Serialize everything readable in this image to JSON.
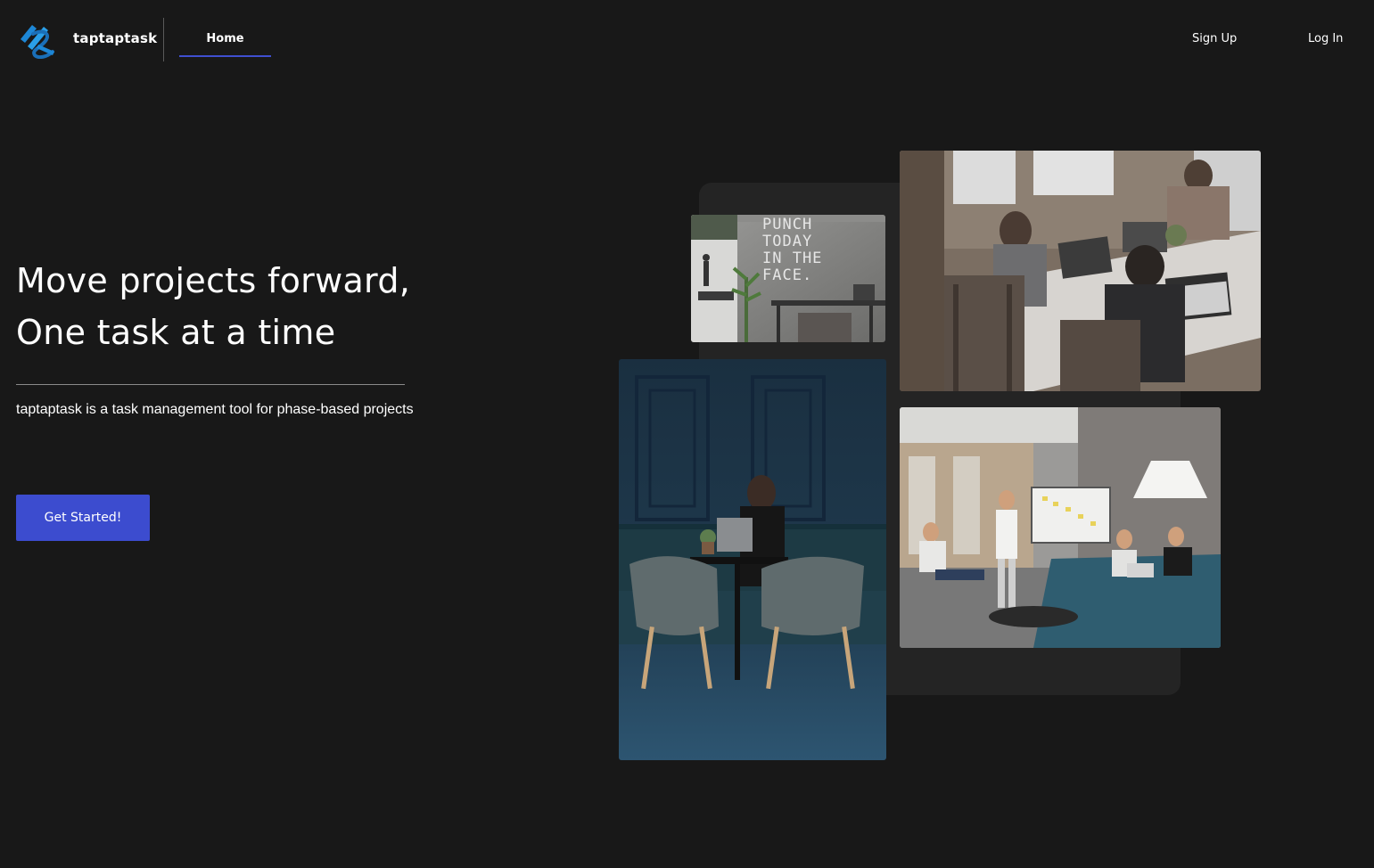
{
  "nav": {
    "brand": "taptaptask",
    "logo_icon": "taptaptask-logo-icon",
    "home_label": "Home",
    "signup_label": "Sign Up",
    "login_label": "Log In",
    "accent_color": "#3f4fd0"
  },
  "hero": {
    "headline_line1": "Move projects forward,",
    "headline_line2": "One task at a time",
    "tagline": "taptaptask is a task management tool for phase-based projects",
    "cta_label": "Get Started!",
    "cta_color": "#3c4ccf"
  },
  "collage": {
    "punch_wall_text": "PUNCH\nTODAY\nIN THE\nFACE."
  },
  "theme": {
    "background": "#181818",
    "panel": "#242424",
    "text": "#ffffff"
  }
}
